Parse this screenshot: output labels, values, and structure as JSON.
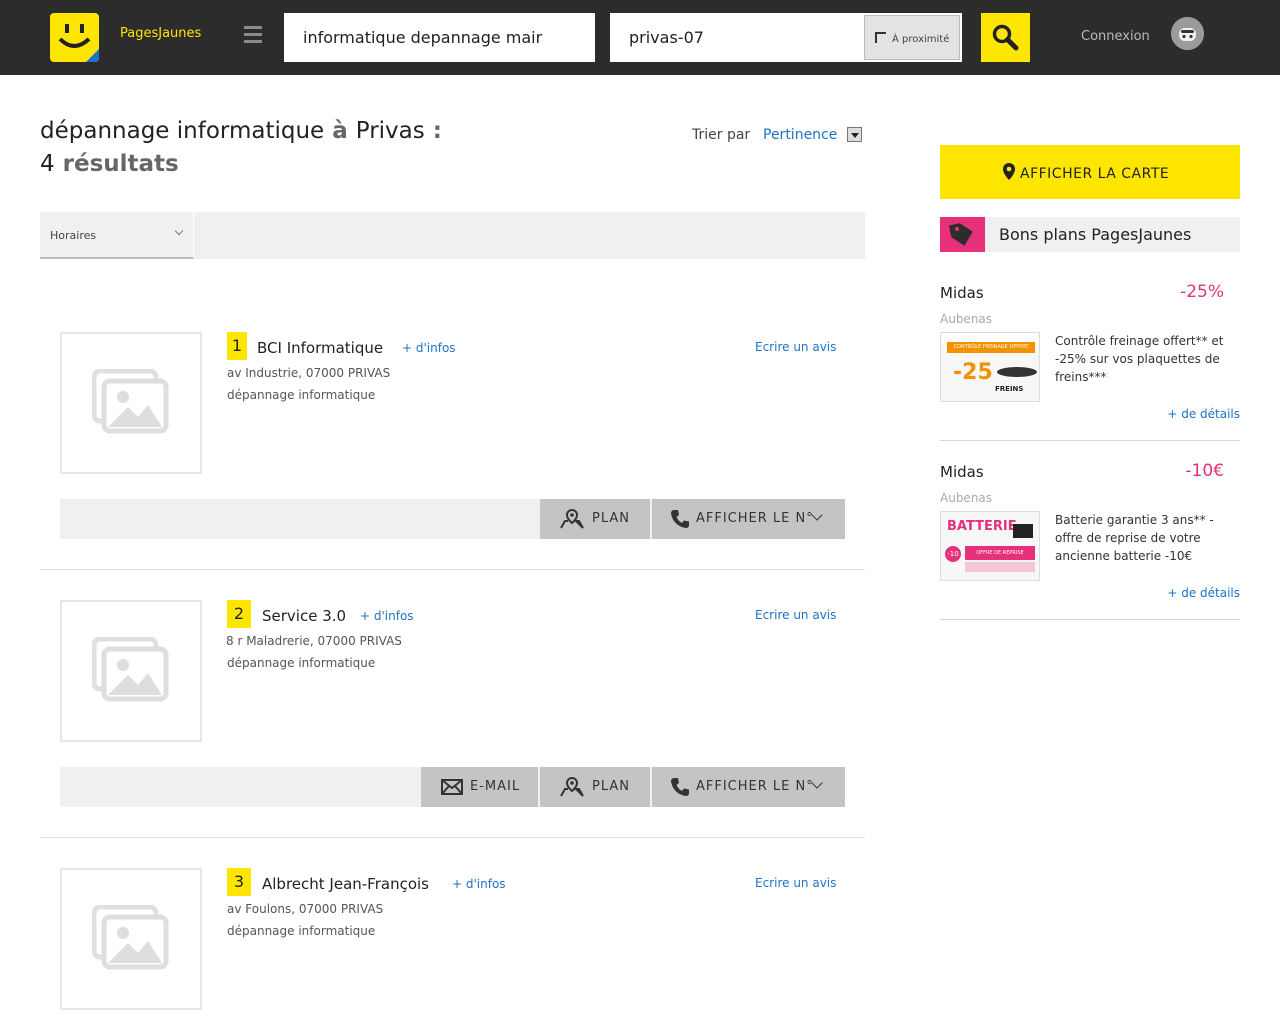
{
  "header": {
    "brand": "PagesJaunes",
    "search_what": "informatique depannage mair",
    "search_where": "privas-07",
    "proximity_label": "À proximité",
    "login_label": "Connexion"
  },
  "results_title": {
    "keyword": "dépannage informatique",
    "preposition": "à",
    "city": "Privas",
    "colon": ":",
    "count": "4",
    "count_label": "résultats"
  },
  "sort": {
    "label": "Trier par",
    "value": "Pertinence"
  },
  "filters": {
    "horaires": "Horaires"
  },
  "results": [
    {
      "rank": "1",
      "name": "BCI Informatique",
      "more_info": "+ d'infos",
      "review": "Ecrire un avis",
      "address": "av Industrie, 07000 PRIVAS",
      "activity": "dépannage informatique",
      "actions": {
        "plan": "PLAN",
        "phone": "AFFICHER LE N°"
      }
    },
    {
      "rank": "2",
      "name": "Service 3.0",
      "more_info": "+ d'infos",
      "review": "Ecrire un avis",
      "address": "8 r Maladrerie, 07000 PRIVAS",
      "activity": "dépannage informatique",
      "actions": {
        "email": "E-MAIL",
        "plan": "PLAN",
        "phone": "AFFICHER LE N°"
      }
    },
    {
      "rank": "3",
      "name": "Albrecht Jean-François",
      "more_info": "+ d'infos",
      "review": "Ecrire un avis",
      "address": "av Foulons, 07000 PRIVAS",
      "activity": "dépannage informatique"
    }
  ],
  "sidebar": {
    "map_button": "AFFICHER LA CARTE",
    "bons_plans_title": "Bons plans PagesJaunes",
    "offers": [
      {
        "name": "Midas",
        "discount": "-25%",
        "city": "Aubenas",
        "description": "Contrôle freinage offert** et -25% sur vos plaquettes de freins***",
        "details": "+ de détails",
        "image_text": {
          "header": "CONTRÔLE FREINAGE OFFERT",
          "big": "-25",
          "small": "FREINS"
        }
      },
      {
        "name": "Midas",
        "discount": "-10€",
        "city": "Aubenas",
        "description": "Batterie garantie 3 ans** - offre de reprise de votre ancienne batterie -10€",
        "details": "+ de détails",
        "image_text": {
          "header": "BATTERIE",
          "big": "-10",
          "small": "OFFRE DE REPRISE"
        }
      }
    ]
  },
  "colors": {
    "brand_yellow": "#ffe600",
    "header_bg": "#2c2c2c",
    "link_blue": "#1e72c8",
    "accent_pink": "#e6307a"
  }
}
